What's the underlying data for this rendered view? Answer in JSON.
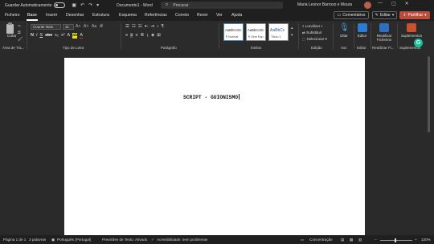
{
  "titlebar": {
    "autosave_label": "Guardar Automaticamente",
    "doc_title": "Documento1 - Word",
    "search_placeholder": "Procurar",
    "user_name": "Maria Leonor Barroso e Moura"
  },
  "menu": {
    "items": [
      "Ficheiro",
      "Base",
      "Inserir",
      "Desenhar",
      "Estrutura",
      "Esquema",
      "Referências",
      "Correio",
      "Rever",
      "Ver",
      "Ajuda"
    ],
    "active": "Base",
    "comments_label": "Comentários",
    "editor_label": "Editar",
    "share_label": "Partilhar",
    "share_color": "#b74d3a"
  },
  "ribbon": {
    "paste_label": "Colar",
    "font_name": "Courier New",
    "font_size": "11",
    "groups": {
      "clipboard": "Área de Tra...",
      "font": "Tipo de Letra",
      "paragraph": "Parágrafo",
      "styles": "Estilos",
      "editing": "Edição",
      "voice": "Voz",
      "editor": "Editor",
      "reuse": "Reutilizar Fi...",
      "addins": "Suplementos"
    },
    "styles": [
      {
        "sample": "AaBbCcDc",
        "name": "¶ Normal"
      },
      {
        "sample": "AaBbCcDc",
        "name": "¶ Sem Esp..."
      },
      {
        "sample": "AaBbCc",
        "name": "Título 1"
      }
    ],
    "find": "Localizar",
    "replace": "Substituir",
    "select": "Selecionar",
    "dictate": "Ditar",
    "editor_btn": "Editor",
    "reuse_btn": "Reutilizar Ficheiros",
    "addins_btn": "Suplementos"
  },
  "document": {
    "text": "SCRIPT - GUIONISMO"
  },
  "status": {
    "page": "Página 1 de 1",
    "words": "3 palavras",
    "language": "Português (Portugal)",
    "predictions": "Previsões de Texto: Ativado",
    "accessibility": "Acessibilidade: sem problemas",
    "focus": "Concentração",
    "zoom": "120%"
  }
}
